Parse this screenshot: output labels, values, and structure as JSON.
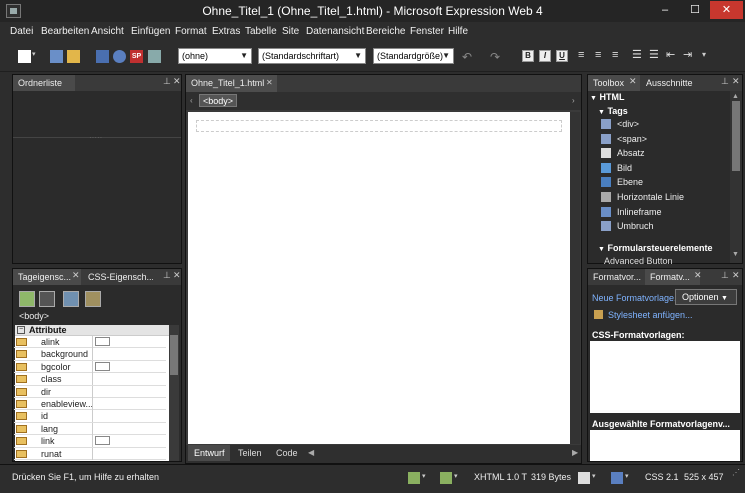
{
  "window": {
    "title": "Ohne_Titel_1 (Ohne_Titel_1.html) - Microsoft Expression Web 4",
    "minimize": "–",
    "maximize": "☐",
    "close": "✕"
  },
  "menu": [
    "Datei",
    "Bearbeiten",
    "Ansicht",
    "Einfügen",
    "Format",
    "Extras",
    "Tabelle",
    "Site",
    "Datenansicht",
    "Bereiche",
    "Fenster",
    "Hilfe"
  ],
  "toolbar": {
    "style_combo": "(ohne)",
    "font_combo": "(Standardschriftart)",
    "size_combo": "(Standardgröße)",
    "bold": "B",
    "italic": "I",
    "underline": "U"
  },
  "folder_panel": {
    "title": "Ordnerliste"
  },
  "tag_panel": {
    "tabs": [
      "Tageigensc...",
      "CSS-Eigensch..."
    ],
    "tag": "<body>",
    "group": "Attribute",
    "attributes": [
      "alink",
      "background",
      "bgcolor",
      "class",
      "dir",
      "enableview...",
      "id",
      "lang",
      "link",
      "runat"
    ]
  },
  "editor": {
    "doc_tab": "Ohne_Titel_1.html",
    "breadcrumb": "<body>",
    "views": [
      "Entwurf",
      "Teilen",
      "Code"
    ]
  },
  "toolbox": {
    "tabs": [
      "Toolbox",
      "Ausschnitte"
    ],
    "section_html": "HTML",
    "section_tags": "Tags",
    "tags": [
      "<div>",
      "<span>",
      "Absatz",
      "Bild",
      "Ebene",
      "Horizontale Linie",
      "Inlineframe",
      "Umbruch"
    ],
    "section_forms": "Formularsteuerelemente",
    "partial_item": "Advanced Button"
  },
  "styles_panel": {
    "tabs": [
      "Formatvor...",
      "Formatv..."
    ],
    "new_style": "Neue Formatvorlage...",
    "options": "Optionen",
    "attach_stylesheet": "Stylesheet anfügen...",
    "css_header": "CSS-Formatvorlagen:",
    "selected_header": "Ausgewählte Formatvorlagenv..."
  },
  "status": {
    "help": "Drücken Sie F1, um Hilfe zu erhalten",
    "doctype": "XHTML 1.0 T",
    "size": "319 Bytes",
    "css": "CSS 2.1",
    "dimensions": "525 x 457"
  }
}
